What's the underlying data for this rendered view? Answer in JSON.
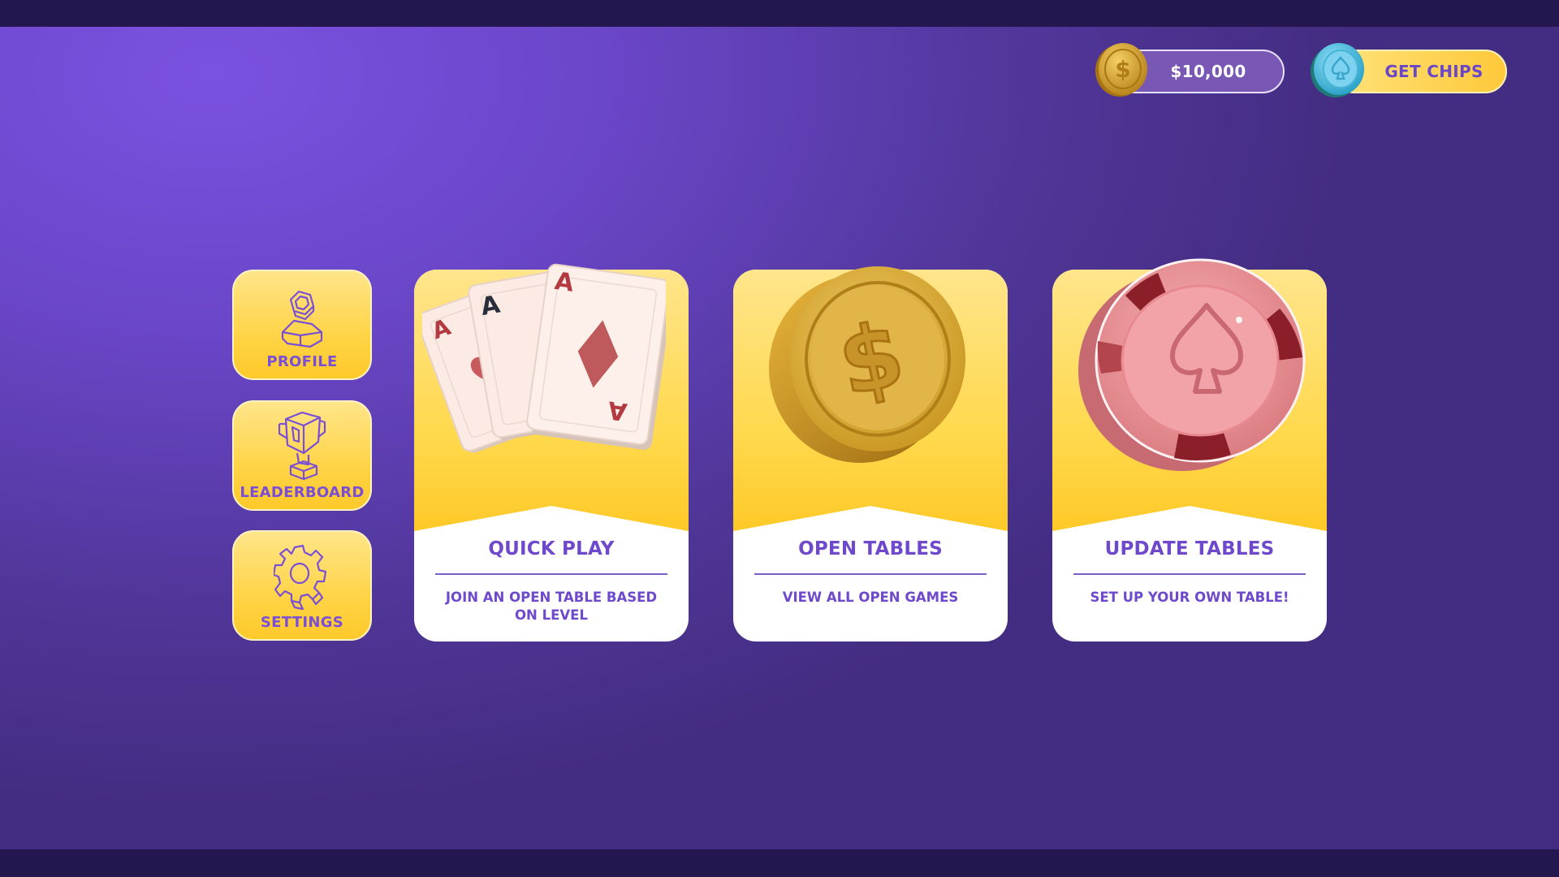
{
  "header": {
    "balance": "$10,000",
    "get_chips_label": "GET CHIPS"
  },
  "side_menu": [
    {
      "label": "PROFILE",
      "icon": "profile-icon"
    },
    {
      "label": "LEADERBOARD",
      "icon": "trophy-icon"
    },
    {
      "label": "SETTINGS",
      "icon": "gear-icon"
    }
  ],
  "cards": [
    {
      "title": "QUICK PLAY",
      "description": "JOIN AN OPEN TABLE BASED ON LEVEL",
      "art": "playing-cards-icon"
    },
    {
      "title": "OPEN TABLES",
      "description": "VIEW ALL OPEN GAMES",
      "art": "gold-coin-icon"
    },
    {
      "title": "UPDATE TABLES",
      "description": "SET UP YOUR OWN TABLE!",
      "art": "poker-chip-icon"
    }
  ],
  "card_art_text": {
    "ace": "A"
  },
  "colors": {
    "accent_purple": "#6e49cc",
    "gold": "#fec93a",
    "background": "#6a46c8"
  }
}
